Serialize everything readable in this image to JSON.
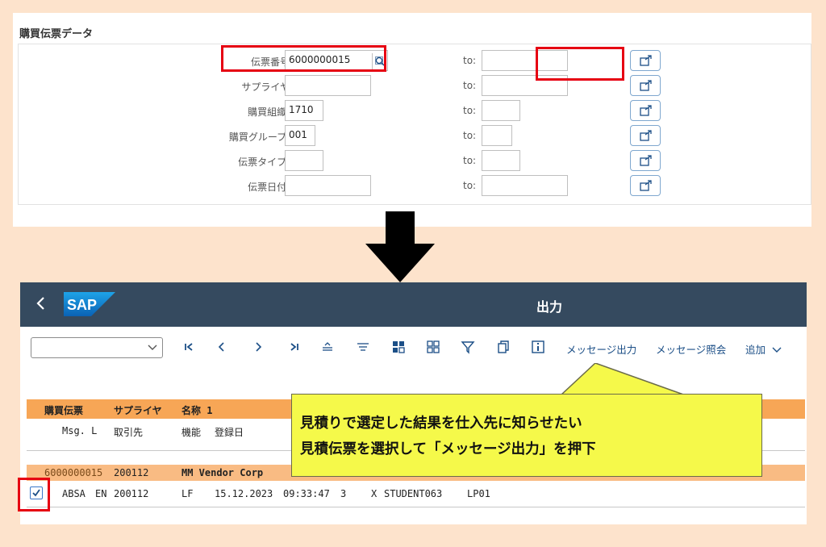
{
  "search_form": {
    "section_title": "購買伝票データ",
    "to_label": "to:",
    "fields": [
      {
        "label": "伝票番号:",
        "value": "6000000015",
        "has_value_help": true
      },
      {
        "label": "サプライヤ:",
        "value": ""
      },
      {
        "label": "購買組織 :",
        "value": "1710"
      },
      {
        "label": "購買グループ :",
        "value": "001"
      },
      {
        "label": "伝票タイプ :",
        "value": ""
      },
      {
        "label": "伝票日付 :",
        "value": ""
      }
    ]
  },
  "shell": {
    "logo_text": "SAP",
    "title": "出力",
    "brand_color": "#354a5f"
  },
  "toolbar": {
    "layout_select_value": "",
    "icons": [
      "first-page-icon",
      "previous-icon",
      "next-icon",
      "last-page-icon",
      "align-center-icon",
      "filter-lines-icon",
      "grid-filled-icon",
      "grid-outline-icon",
      "funnel-icon",
      "copy-icon",
      "info-icon"
    ],
    "message_output_label": "メッセージ出力",
    "message_display_label": "メッセージ照会",
    "add_label": "追加"
  },
  "list": {
    "header1": {
      "c1": "購買伝票",
      "c2": "サプライヤ",
      "c3": "名称 1"
    },
    "header2": {
      "c1": "Msg. L",
      "c2": "取引先",
      "c3": "機能",
      "c4": "登録日"
    },
    "group_row": {
      "doc": "6000000015",
      "supplier": "200112",
      "name": "MM Vendor Corp"
    },
    "detail_row": {
      "msg": "ABSA",
      "lang": "EN",
      "partner": "200112",
      "func": "LF",
      "date": "15.12.2023",
      "time": "09:33:47",
      "n": "3",
      "flag": "X",
      "user": "STUDENT063",
      "printer": "LP01",
      "checked": true
    }
  },
  "callout": {
    "line1": "見積りで選定した結果を仕入先に知らせたい",
    "line2": "見積伝票を選択して「メッセージ出力」を押下",
    "color": "#f5f94a"
  },
  "highlight_color": "#e60012"
}
